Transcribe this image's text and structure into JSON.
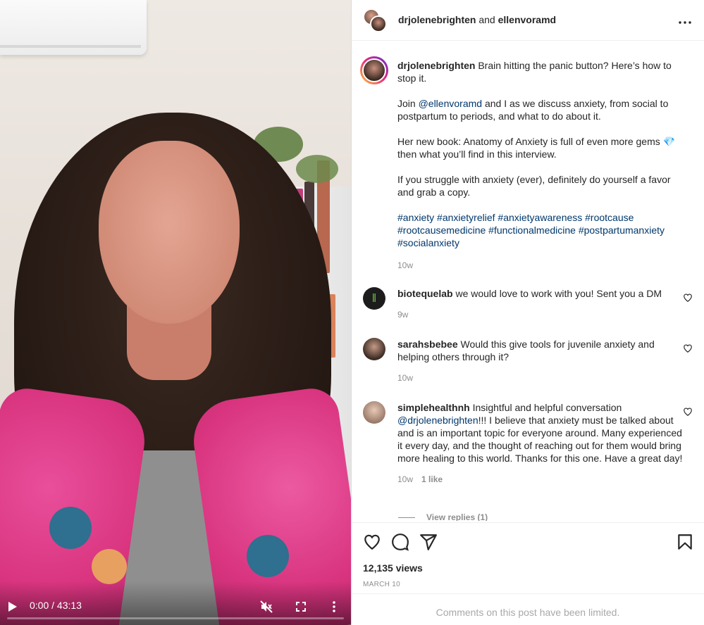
{
  "video": {
    "time": "0:00 / 43:13",
    "progress": 0
  },
  "header": {
    "user1": "drjolenebrighten",
    "joiner": "and",
    "user2": "ellenvoramd"
  },
  "caption": {
    "username": "drjolenebrighten",
    "line1": "Brain hitting the panic button? Here’s how to stop it.",
    "p2_pre": "Join ",
    "p2_mention": "@ellenvoramd",
    "p2_post": " and I as we discuss anxiety, from social to postpartum to periods, and what to do about it.",
    "p3": "Her new book: Anatomy of Anxiety is full of even more gems 💎 then what you’ll find in this interview.",
    "p4": "If you struggle with anxiety (ever), definitely do yourself a favor and grab a copy.",
    "hashtags": "#anxiety #anxietyrelief #anxietyawareness #rootcause #rootcausemedicine #functionalmedicine #postpartumanxiety #socialanxiety",
    "time": "10w"
  },
  "comments": [
    {
      "username": "biotequelab",
      "text": "we would love to work with you! Sent you a DM",
      "time": "9w"
    },
    {
      "username": "sarahsbebee",
      "text": "Would this give tools for juvenile anxiety and helping others through it?",
      "time": "10w"
    },
    {
      "username": "simplehealthnh",
      "text_pre": "Insightful and helpful conversation ",
      "mention": "@drjolenebrighten",
      "text_post": "!!! I believe that anxiety must be talked about and is an important topic for everyone around. Many experienced it every day, and the thought of reaching out for them would bring more healing to this world. Thanks for this one. Have a great day!",
      "time": "10w",
      "likes": "1 like",
      "view_replies": "View replies (1)"
    }
  ],
  "footer": {
    "views": "12,135 views",
    "date": "MARCH 10",
    "limited": "Comments on this post have been limited."
  },
  "colors": {
    "link": "#00376b",
    "muted": "#8e8e8e",
    "text": "#262626"
  }
}
